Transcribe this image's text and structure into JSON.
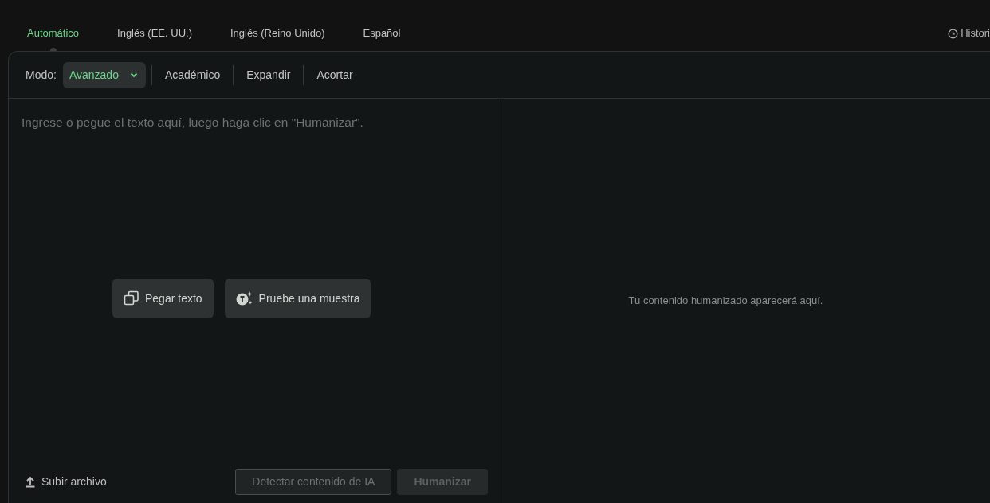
{
  "language_tabs": [
    {
      "label": "Automático",
      "selected": true
    },
    {
      "label": "Inglés (EE. UU.)",
      "selected": false
    },
    {
      "label": "Inglés (Reino Unido)",
      "selected": false
    },
    {
      "label": "Español",
      "selected": false
    }
  ],
  "history_link": {
    "label": "Histori"
  },
  "mode": {
    "label": "Modo:",
    "value": "Avanzado"
  },
  "mode_options": [
    {
      "label": "Académico"
    },
    {
      "label": "Expandir"
    },
    {
      "label": "Acortar"
    }
  ],
  "input": {
    "placeholder": "Ingrese o pegue el texto aquí, luego haga clic en \"Humanizar\"."
  },
  "input_actions": [
    {
      "kind": "paste",
      "label": "Pegar texto"
    },
    {
      "kind": "sample",
      "label": "Pruebe una muestra"
    }
  ],
  "upload": {
    "label": "Subir archivo"
  },
  "buttons": [
    {
      "kind": "outline",
      "label": "Detectar contenido de IA",
      "disabled": true
    },
    {
      "kind": "solid",
      "label": "Humanizar",
      "disabled": true
    }
  ],
  "output": {
    "placeholder": "Tu contenido humanizado aparecerá aquí."
  }
}
